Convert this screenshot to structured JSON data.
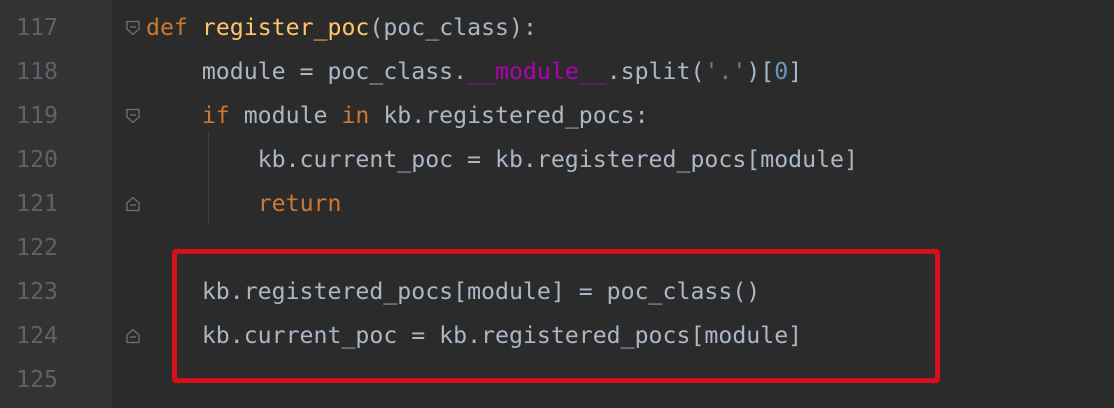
{
  "editor": {
    "lines": [
      {
        "number": "117",
        "fold": "fold-open",
        "tokens": [
          {
            "t": "def",
            "c": "kw"
          },
          {
            "t": " ",
            "c": ""
          },
          {
            "t": "register_poc",
            "c": "fn"
          },
          {
            "t": "(poc_class):",
            "c": ""
          }
        ]
      },
      {
        "number": "118",
        "fold": "",
        "tokens": [
          {
            "t": "    module = poc_class.",
            "c": ""
          },
          {
            "t": "__module__",
            "c": "dn"
          },
          {
            "t": ".split(",
            "c": ""
          },
          {
            "t": "'.'",
            "c": "st"
          },
          {
            "t": ")[",
            "c": ""
          },
          {
            "t": "0",
            "c": "nm"
          },
          {
            "t": "]",
            "c": ""
          }
        ]
      },
      {
        "number": "119",
        "fold": "fold-open",
        "tokens": [
          {
            "t": "    ",
            "c": ""
          },
          {
            "t": "if",
            "c": "kw"
          },
          {
            "t": " module ",
            "c": ""
          },
          {
            "t": "in",
            "c": "kw"
          },
          {
            "t": " kb.registered_pocs:",
            "c": ""
          }
        ]
      },
      {
        "number": "120",
        "fold": "",
        "tokens": [
          {
            "t": "        kb.current_poc = kb.registered_pocs[module]",
            "c": ""
          }
        ]
      },
      {
        "number": "121",
        "fold": "fold-close",
        "tokens": [
          {
            "t": "        ",
            "c": ""
          },
          {
            "t": "return",
            "c": "kw"
          }
        ]
      },
      {
        "number": "122",
        "fold": "",
        "tokens": []
      },
      {
        "number": "123",
        "fold": "",
        "tokens": [
          {
            "t": "    kb.registered_pocs[module] = poc_class()",
            "c": ""
          }
        ]
      },
      {
        "number": "124",
        "fold": "fold-close",
        "tokens": [
          {
            "t": "    kb.current_poc = kb.registered_pocs[module]",
            "c": ""
          }
        ]
      },
      {
        "number": "125",
        "fold": "",
        "tokens": []
      }
    ]
  },
  "colors": {
    "background": "#2b2b2b",
    "gutter": "#313335",
    "line_number": "#606366",
    "text": "#a9b7c6",
    "keyword": "#cc7832",
    "function_name": "#ffc66d",
    "dunder": "#b200b2",
    "string": "#6a8759",
    "number": "#6897bb",
    "highlight_box": "#d6101a"
  },
  "icons": {
    "fold-open": "fold-open-icon",
    "fold-close": "fold-close-icon"
  }
}
